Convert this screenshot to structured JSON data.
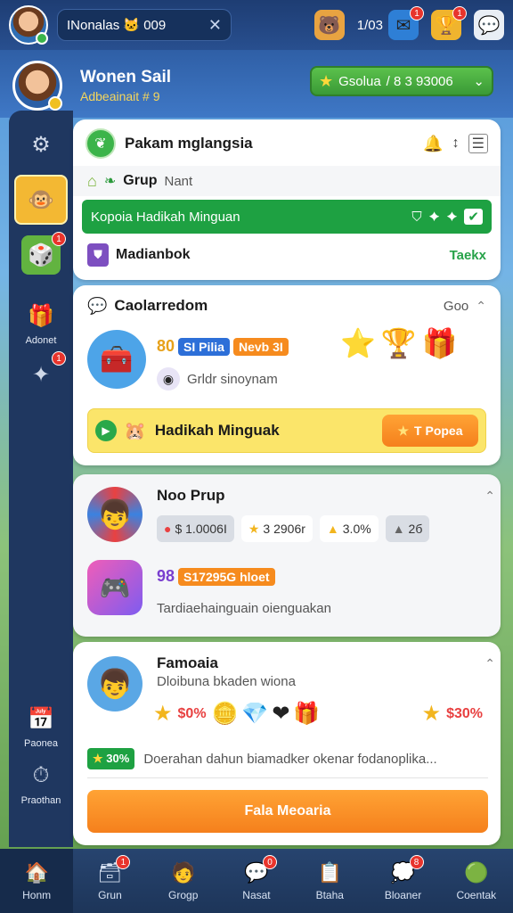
{
  "topbar": {
    "search_value": "INonalas 🐱 009",
    "clear_icon": "close-icon",
    "counter_text": "1/03",
    "badges": [
      "1",
      "1"
    ]
  },
  "profile": {
    "name": "Wonen Sail",
    "subtitle": "Adbeainait # 9",
    "status_label": "Gsolua",
    "status_value": "/ 8 3 93006"
  },
  "sidebar": {
    "items": [
      {
        "label": "",
        "icon": "gear-icon"
      },
      {
        "label": "",
        "icon": "face-icon"
      },
      {
        "label": "",
        "icon": "cube-icon",
        "badge": "1"
      },
      {
        "label": "Adonet",
        "icon": "gift-icon"
      },
      {
        "label": "",
        "icon": "puzzle-icon",
        "badge": "1"
      },
      {
        "label": "Paonea",
        "icon": "calendar-icon"
      },
      {
        "label": "Praothan",
        "icon": "clock-icon"
      }
    ]
  },
  "card1": {
    "title": "Pakam mglangsia",
    "group_label": "Grup",
    "group_sub": "Nant",
    "green_bar_text": "Kopoia Hadikah Minguan",
    "row_label": "Madianbok",
    "row_action": "Taekx"
  },
  "card2": {
    "title": "Caolarredom",
    "header_right": "Goo",
    "tag1": "80",
    "tag2": "SI Pilia",
    "tag3": "Nevb 3I",
    "sub": "Grldr sinoynam",
    "bar_label": "Hadikah Minguak",
    "bar_button": "T Popea"
  },
  "card3": {
    "title": "Noo Prup",
    "chips": [
      "$ 1.0006I",
      "3 2906r",
      "3.0%",
      "2б"
    ],
    "promo_prefix": "98",
    "promo_tag": "S17295G hloet",
    "desc": "Tardiaehainguain oienguakan"
  },
  "card4": {
    "title": "Famoaia",
    "sub": "Dloibuna bkaden wiona",
    "reward_left": "$0%",
    "reward_right": "$30%",
    "tag": "30%",
    "desc": "Doerahan dahun biamadker okenar fodanoplika...",
    "button": "Fala Meoaria"
  },
  "bottomnav": {
    "items": [
      {
        "label": "Honm",
        "icon": "home-icon"
      },
      {
        "label": "Grun",
        "icon": "box-icon",
        "badge": "1"
      },
      {
        "label": "Grogp",
        "icon": "person-icon"
      },
      {
        "label": "Nasat",
        "icon": "chat-icon",
        "badge": "0"
      },
      {
        "label": "Btaha",
        "icon": "clipboard-icon"
      },
      {
        "label": "Bloaner",
        "icon": "message-icon",
        "badge": "8"
      },
      {
        "label": "Coentak",
        "icon": "contact-icon"
      }
    ]
  },
  "colors": {
    "accent_green": "#1ea142",
    "accent_orange": "#f5801c",
    "accent_yellow": "#fbe56a",
    "nav_dark": "#1d3559"
  }
}
